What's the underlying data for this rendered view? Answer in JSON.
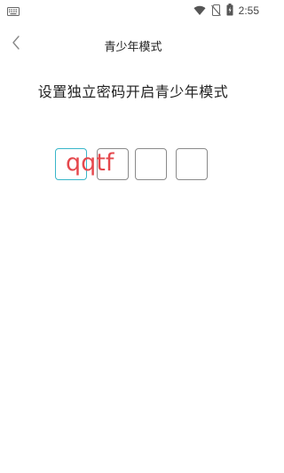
{
  "status_bar": {
    "time": "2:55",
    "icons": [
      "keyboard-icon",
      "wifi-icon",
      "no-sim-icon",
      "battery-icon"
    ]
  },
  "header": {
    "title": "青少年模式",
    "back_icon": "chevron-left-icon"
  },
  "prompt": "设置独立密码开启青少年模式",
  "code": {
    "value": "qqtf",
    "length": 4
  },
  "colors": {
    "active_box": "#38b6c9",
    "input_text": "#e5484d",
    "box_border": "#8a8a8a"
  }
}
